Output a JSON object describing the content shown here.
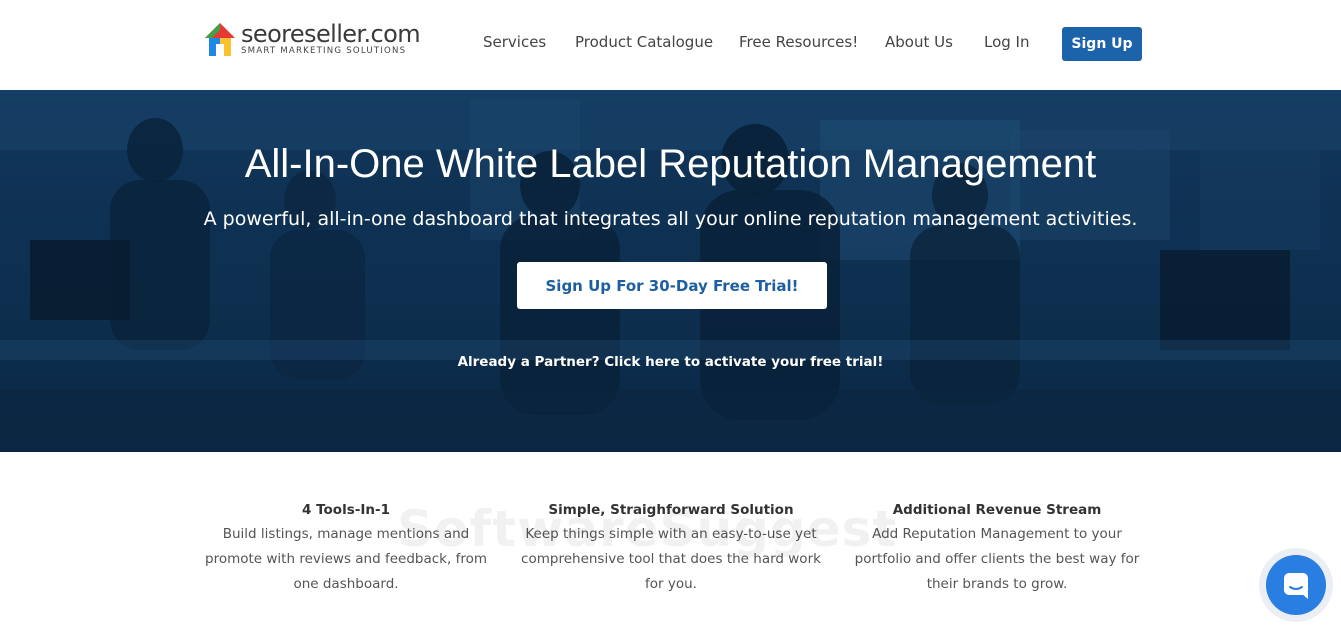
{
  "header": {
    "logo_name": "seoreseller.com",
    "logo_tagline": "SMART MARKETING SOLUTIONS",
    "nav": [
      {
        "label": "Services"
      },
      {
        "label": "Product Catalogue"
      },
      {
        "label": "Free Resources!"
      },
      {
        "label": "About Us"
      },
      {
        "label": "Log In"
      }
    ],
    "signup_label": "Sign Up"
  },
  "hero": {
    "title": "All-In-One White Label Reputation Management",
    "subtitle": "A powerful, all-in-one dashboard that integrates all your online reputation management activities.",
    "cta_label": "Sign Up For 30-Day Free Trial!",
    "partner_link": "Already a Partner? Click here to activate your free trial!"
  },
  "features": [
    {
      "title": "4 Tools-In-1",
      "desc": "Build listings, manage mentions and promote with reviews and feedback, from one dashboard."
    },
    {
      "title": "Simple, Straighforward Solution",
      "desc": "Keep things simple with an easy-to-use yet comprehensive tool that does the hard work for you."
    },
    {
      "title": "Additional Revenue Stream",
      "desc": "Add Reputation Management to your portfolio and offer clients the best way for their brands to grow."
    }
  ],
  "watermark": "SoftwareSuggest",
  "colors": {
    "brand_blue": "#1d63aa",
    "hero_overlay": "#0f2e4c",
    "chat_blue": "#2a7de1"
  },
  "icons": {
    "logo": "house-logo-icon",
    "chat": "chat-bubble-icon"
  }
}
